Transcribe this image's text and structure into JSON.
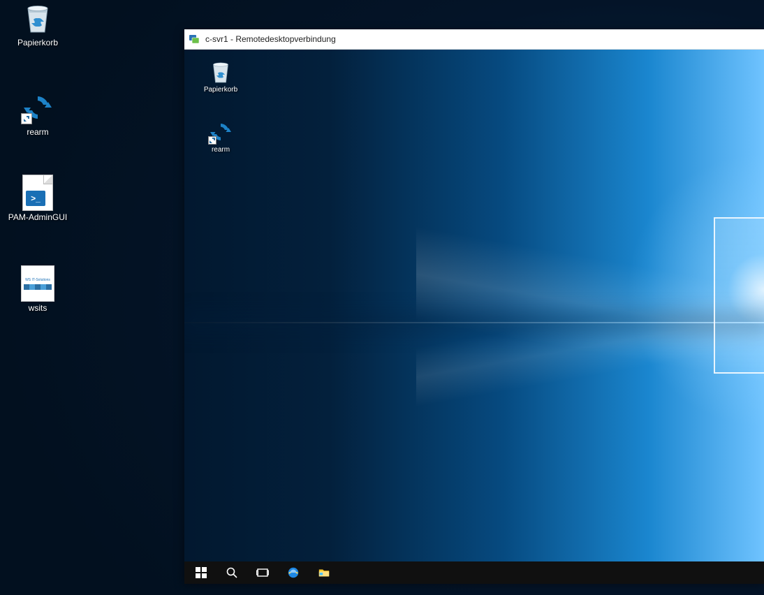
{
  "host_desktop": {
    "icons": {
      "recycle_bin": {
        "label": "Papierkorb"
      },
      "rearm": {
        "label": "rearm"
      },
      "pam_admin": {
        "label": "PAM-AdminGUI"
      },
      "wsits": {
        "label": "wsits",
        "logo_text": "WS IT-Solutions"
      }
    }
  },
  "rdp_window": {
    "title": "c-svr1 - Remotedesktopverbindung",
    "remote_desktop": {
      "icons": {
        "recycle_bin": {
          "label": "Papierkorb"
        },
        "rearm": {
          "label": "rearm"
        }
      }
    },
    "taskbar": {
      "start": "Start",
      "search": "Suche",
      "taskview": "Task-Ansicht",
      "ie": "Internet Explorer",
      "explorer": "Datei-Explorer"
    }
  }
}
